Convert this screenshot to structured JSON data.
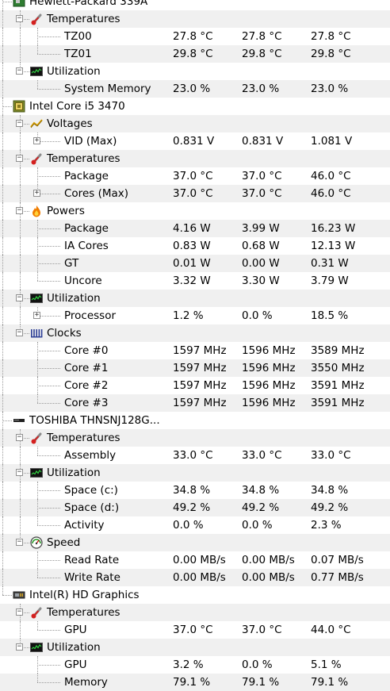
{
  "hardware": [
    {
      "name": "Hewlett-Packard 339A",
      "icon": "motherboard-icon",
      "groups": [
        {
          "name": "Temperatures",
          "icon": "thermometer-icon",
          "sensors": [
            {
              "name": "TZ00",
              "value": "27.8 °C",
              "min": "27.8 °C",
              "max": "27.8 °C"
            },
            {
              "name": "TZ01",
              "value": "29.8 °C",
              "min": "29.8 °C",
              "max": "29.8 °C"
            }
          ]
        },
        {
          "name": "Utilization",
          "icon": "load-monitor-icon",
          "sensors": [
            {
              "name": "System Memory",
              "value": "23.0 %",
              "min": "23.0 %",
              "max": "23.0 %"
            }
          ]
        }
      ]
    },
    {
      "name": "Intel Core i5 3470",
      "icon": "cpu-icon",
      "groups": [
        {
          "name": "Voltages",
          "icon": "voltage-icon",
          "sensors": [
            {
              "name": "VID (Max)",
              "value": "0.831 V",
              "min": "0.831 V",
              "max": "1.081 V",
              "expandable": true
            }
          ]
        },
        {
          "name": "Temperatures",
          "icon": "thermometer-icon",
          "sensors": [
            {
              "name": "Package",
              "value": "37.0 °C",
              "min": "37.0 °C",
              "max": "46.0 °C"
            },
            {
              "name": "Cores (Max)",
              "value": "37.0 °C",
              "min": "37.0 °C",
              "max": "46.0 °C",
              "expandable": true
            }
          ]
        },
        {
          "name": "Powers",
          "icon": "flame-icon",
          "sensors": [
            {
              "name": "Package",
              "value": "4.16 W",
              "min": "3.99 W",
              "max": "16.23 W"
            },
            {
              "name": "IA Cores",
              "value": "0.83 W",
              "min": "0.68 W",
              "max": "12.13 W"
            },
            {
              "name": "GT",
              "value": "0.01 W",
              "min": "0.00 W",
              "max": "0.31 W"
            },
            {
              "name": "Uncore",
              "value": "3.32 W",
              "min": "3.30 W",
              "max": "3.79 W"
            }
          ]
        },
        {
          "name": "Utilization",
          "icon": "load-monitor-icon",
          "sensors": [
            {
              "name": "Processor",
              "value": "1.2 %",
              "min": "0.0 %",
              "max": "18.5 %",
              "expandable": true
            }
          ]
        },
        {
          "name": "Clocks",
          "icon": "clock-icon",
          "sensors": [
            {
              "name": "Core #0",
              "value": "1597 MHz",
              "min": "1596 MHz",
              "max": "3589 MHz"
            },
            {
              "name": "Core #1",
              "value": "1597 MHz",
              "min": "1596 MHz",
              "max": "3550 MHz"
            },
            {
              "name": "Core #2",
              "value": "1597 MHz",
              "min": "1596 MHz",
              "max": "3591 MHz"
            },
            {
              "name": "Core #3",
              "value": "1597 MHz",
              "min": "1596 MHz",
              "max": "3591 MHz"
            }
          ]
        }
      ]
    },
    {
      "name": "TOSHIBA THNSNJ128G...",
      "icon": "drive-icon",
      "groups": [
        {
          "name": "Temperatures",
          "icon": "thermometer-icon",
          "sensors": [
            {
              "name": "Assembly",
              "value": "33.0 °C",
              "min": "33.0 °C",
              "max": "33.0 °C"
            }
          ]
        },
        {
          "name": "Utilization",
          "icon": "load-monitor-icon",
          "sensors": [
            {
              "name": "Space (c:)",
              "value": "34.8 %",
              "min": "34.8 %",
              "max": "34.8 %"
            },
            {
              "name": "Space (d:)",
              "value": "49.2 %",
              "min": "49.2 %",
              "max": "49.2 %"
            },
            {
              "name": "Activity",
              "value": "0.0 %",
              "min": "0.0 %",
              "max": "2.3 %"
            }
          ]
        },
        {
          "name": "Speed",
          "icon": "gauge-icon",
          "sensors": [
            {
              "name": "Read Rate",
              "value": "0.00 MB/s",
              "min": "0.00 MB/s",
              "max": "0.07 MB/s"
            },
            {
              "name": "Write Rate",
              "value": "0.00 MB/s",
              "min": "0.00 MB/s",
              "max": "0.77 MB/s"
            }
          ]
        }
      ]
    },
    {
      "name": "Intel(R) HD Graphics",
      "icon": "gpu-icon",
      "groups": [
        {
          "name": "Temperatures",
          "icon": "thermometer-icon",
          "sensors": [
            {
              "name": "GPU",
              "value": "37.0 °C",
              "min": "37.0 °C",
              "max": "44.0 °C"
            }
          ]
        },
        {
          "name": "Utilization",
          "icon": "load-monitor-icon",
          "sensors": [
            {
              "name": "GPU",
              "value": "3.2 %",
              "min": "0.0 %",
              "max": "5.1 %"
            },
            {
              "name": "Memory",
              "value": "79.1 %",
              "min": "79.1 %",
              "max": "79.1 %"
            }
          ]
        }
      ]
    }
  ]
}
